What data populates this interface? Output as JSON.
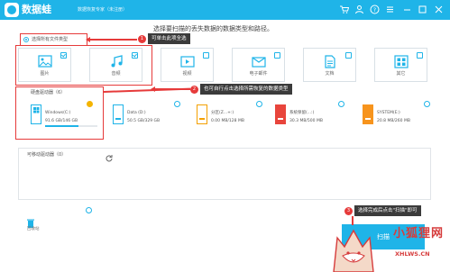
{
  "titlebar": {
    "app_name": "数据蛙",
    "window_title": "数据恢复专家（未注册）"
  },
  "headline": "选择要扫描的丢失数据的数据类型和路径。",
  "select_all_label": "选择所有文件类型",
  "file_types": [
    {
      "label": "图片",
      "checked": true,
      "icon": "image-icon"
    },
    {
      "label": "音频",
      "checked": true,
      "icon": "music-icon"
    },
    {
      "label": "视频",
      "checked": false,
      "icon": "video-icon"
    },
    {
      "label": "电子邮件",
      "checked": false,
      "icon": "email-icon"
    },
    {
      "label": "文档",
      "checked": false,
      "icon": "document-icon"
    },
    {
      "label": "其它",
      "checked": false,
      "icon": "other-files-icon"
    }
  ],
  "hard_drives": {
    "title": "硬盘驱动器（6）",
    "drives": [
      {
        "name": "Windows(C:)",
        "size": "91.6 GB/146 GB",
        "selected": true,
        "used_fraction": 0.63
      },
      {
        "name": "Data (D:)",
        "size": "50.5 GB/329 GB",
        "selected": false
      },
      {
        "name": "分区(Z...+:)",
        "size": "0.00 MB/128 MB",
        "selected": false
      },
      {
        "name": "系统保留(...:)",
        "size": "30.3 MB/500 MB",
        "selected": false
      },
      {
        "name": "SYSTEM(E:)",
        "size": "20.8 MB/260 MB",
        "selected": false
      }
    ]
  },
  "removable": {
    "title": "可移动驱动器（0）"
  },
  "recycle_bin": "回收站",
  "scan_button": "扫描",
  "annotations": [
    {
      "num": "1",
      "text": "可单击此项全选"
    },
    {
      "num": "2",
      "text": "也可自行点击选择所需恢复的数据类型"
    },
    {
      "num": "3",
      "text": "选择完成后点击\"扫描\"即可"
    }
  ],
  "watermark": {
    "text": "小狐狸网",
    "url": "XHLWS.CN"
  },
  "colors": {
    "accent": "#1fb4e8",
    "annotation": "#e63a3a",
    "callout_bg": "#3b3b3b"
  }
}
